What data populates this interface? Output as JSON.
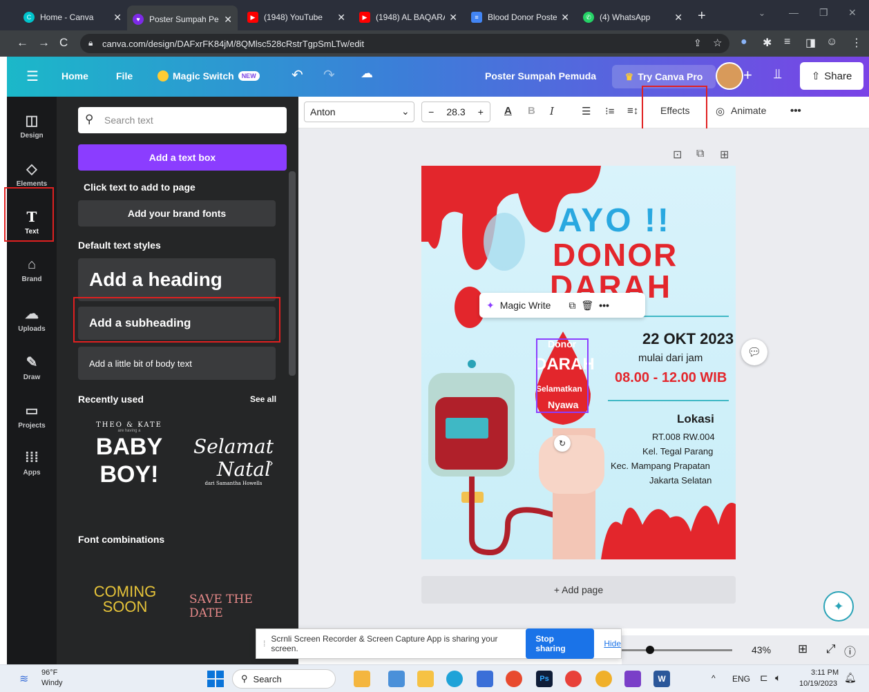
{
  "browser": {
    "tabs": [
      {
        "label": "Home - Canva",
        "color": "#00c4cc"
      },
      {
        "label": "Poster Sumpah Pe",
        "color": "#7d2ae8"
      },
      {
        "label": "(1948) YouTube",
        "color": "#ff0000"
      },
      {
        "label": "(1948) AL BAQARA",
        "color": "#ff0000"
      },
      {
        "label": "Blood Donor Poste",
        "color": "#4285f4"
      },
      {
        "label": "(4) WhatsApp",
        "color": "#25d366"
      }
    ],
    "url": "canva.com/design/DAFxrFK84jM/8QMlsc528cRstrTgpSmLTw/edit"
  },
  "header": {
    "home": "Home",
    "file": "File",
    "magic_switch": "Magic Switch",
    "new_badge": "NEW",
    "doc_title": "Poster Sumpah Pemuda",
    "try_pro": "Try Canva Pro",
    "share": "Share"
  },
  "rail": [
    {
      "label": "Design",
      "icon": "layout-icon"
    },
    {
      "label": "Elements",
      "icon": "shapes-icon"
    },
    {
      "label": "Text",
      "icon": "text-icon"
    },
    {
      "label": "Brand",
      "icon": "brand-icon"
    },
    {
      "label": "Uploads",
      "icon": "upload-icon"
    },
    {
      "label": "Draw",
      "icon": "pen-icon"
    },
    {
      "label": "Projects",
      "icon": "folder-icon"
    },
    {
      "label": "Apps",
      "icon": "grid-icon"
    }
  ],
  "panel": {
    "search_placeholder": "Search text",
    "add_textbox": "Add a text box",
    "click_to_add": "Click text to add to page",
    "brand_fonts": "Add your brand fonts",
    "default_styles": "Default text styles",
    "heading": "Add a heading",
    "subheading": "Add a subheading",
    "body": "Add a little bit of body text",
    "recently_used": "Recently used",
    "see_all": "See all",
    "recent1_top": "THEO & KATE",
    "recent1_small": "are having a",
    "recent1_main": "BABY BOY!",
    "recent2_main1": "Selamat",
    "recent2_main2": "Natal",
    "recent2_small": "dari Samantha Howells",
    "font_combinations": "Font combinations",
    "combo1": "COMING SOON",
    "combo2": "SAVE THE DATE"
  },
  "toolbar": {
    "font": "Anton",
    "size": "28.3",
    "effects": "Effects",
    "animate": "Animate"
  },
  "poster": {
    "ayo": "AYO !!",
    "donor": "DONOR",
    "darah": "DARAH",
    "date": "22 OKT 2023",
    "mulai": "mulai dari jam",
    "time": "08.00 - 12.00 WIB",
    "drop_donor": "Donor",
    "drop_darah": "DARAH",
    "drop_selamatkan": "Selamatkan",
    "drop_nyawa": "Nyawa",
    "lokasi": "Lokasi",
    "addr1": "RT.008 RW.004",
    "addr2": "Kel. Tegal Parang",
    "addr3": "Kec. Mampang Prapatan",
    "addr4": "Jakarta Selatan",
    "colors": {
      "blue": "#29a8e0",
      "red": "#e3262c",
      "dark": "#1b1b1b"
    }
  },
  "magic_write": "Magic Write",
  "add_page": "+ Add page",
  "share_bar": {
    "message": "Scrnli Screen Recorder & Screen Capture App is sharing your screen.",
    "stop": "Stop sharing",
    "hide": "Hide"
  },
  "zoom": "43%",
  "taskbar": {
    "weather_temp": "96°F",
    "weather_desc": "Windy",
    "search": "Search",
    "lang": "ENG",
    "time": "3:11 PM",
    "date": "10/19/2023"
  }
}
